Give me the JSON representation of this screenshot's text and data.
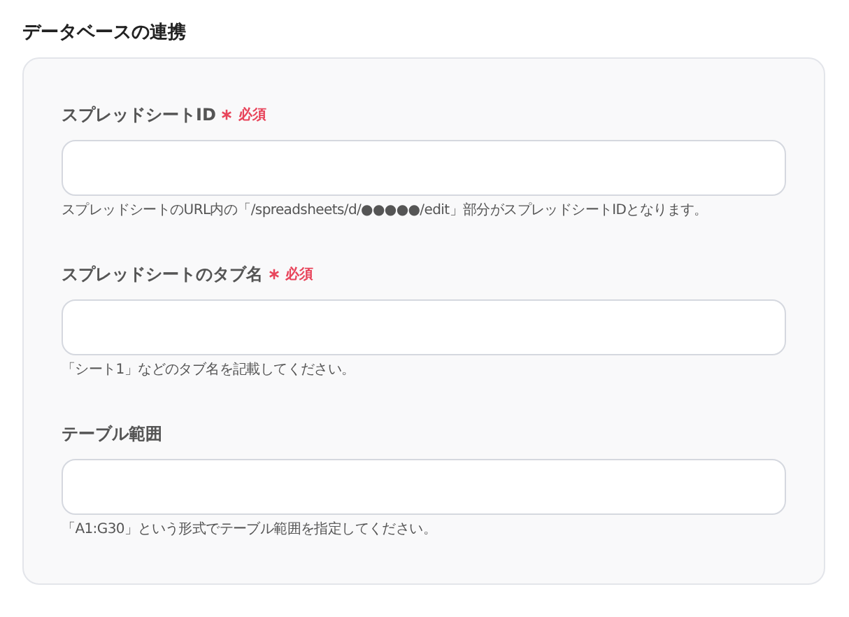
{
  "section_title": "データベースの連携",
  "fields": [
    {
      "label": "スプレッドシートID",
      "required": true,
      "required_label": "必須",
      "hint": "スプレッドシートのURL内の「/spreadsheets/d/●●●●●/edit」部分がスプレッドシートIDとなります。"
    },
    {
      "label": "スプレッドシートのタブ名",
      "required": true,
      "required_label": "必須",
      "hint": "「シート1」などのタブ名を記載してください。"
    },
    {
      "label": "テーブル範囲",
      "required": false,
      "hint": "「A1:G30」という形式でテーブル範囲を指定してください。"
    }
  ]
}
